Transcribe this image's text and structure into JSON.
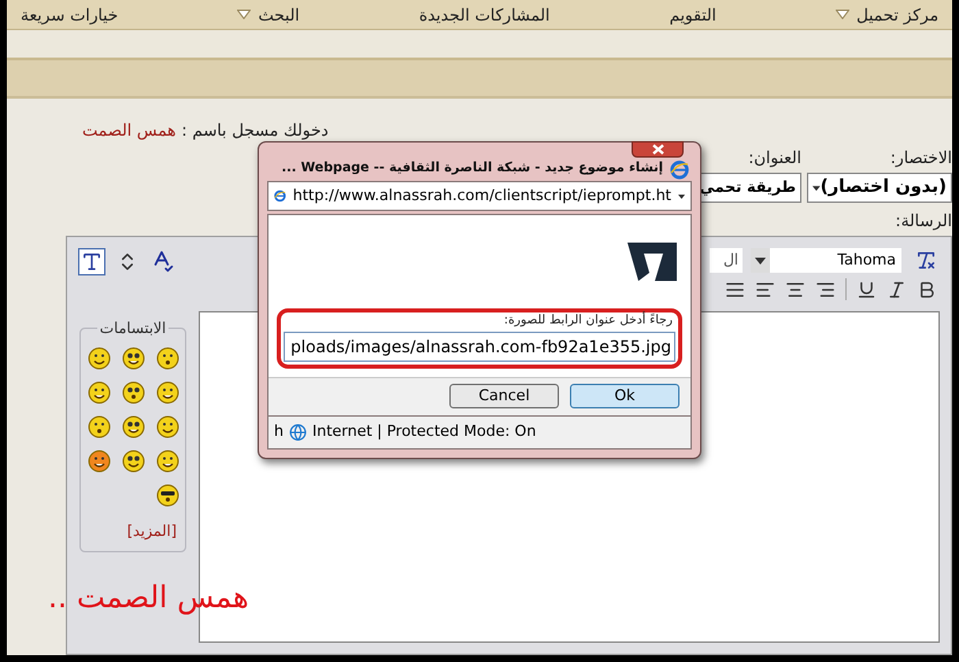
{
  "nav": [
    {
      "label": "مركز تحميل",
      "menu": true
    },
    {
      "label": "التقويم",
      "menu": false
    },
    {
      "label": "المشاركات الجديدة",
      "menu": false
    },
    {
      "label": "البحث",
      "menu": true
    },
    {
      "label": "خيارات سريعة",
      "menu": false
    }
  ],
  "login": {
    "text": "دخولك مسجل باسم :",
    "username": "همس الصمت"
  },
  "form": {
    "prefix_label": "الاختصار:",
    "prefix_value": "(بدون اختصار)",
    "title_label": "العنوان:",
    "title_value": "طريقة تحمي",
    "message_label": "الرسالة:"
  },
  "editor": {
    "font": "Tahoma",
    "size": "ال",
    "smilies_title": "الابتسامات",
    "more_link": "[المزيد]"
  },
  "dialog": {
    "title": "إنشاء موضوع جديد - شبكة الناصرة الثقافية -- Webpage ...",
    "address": "http://www.alnassrah.com/clientscript/ieprompt.ht",
    "prompt": "رجاءً أدخل عنوان الرابط للصورة:",
    "value": "ploads/images/alnassrah.com-fb92a1e355.jpg",
    "buttons": [
      {
        "label": "Ok",
        "default": true
      },
      {
        "label": "Cancel",
        "default": false
      }
    ],
    "status_prefix": "h",
    "status": "Internet | Protected Mode: On"
  },
  "signature": "همس الصمت .."
}
